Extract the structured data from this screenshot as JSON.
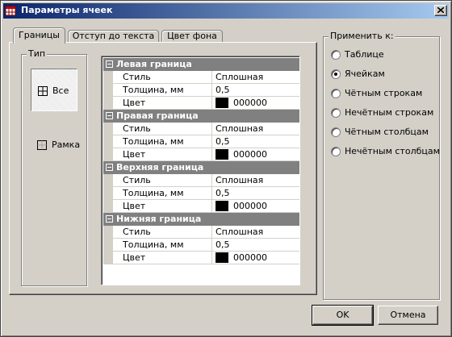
{
  "window": {
    "title": "Параметры ячеек"
  },
  "tabs": [
    {
      "label": "Границы",
      "active": true
    },
    {
      "label": "Отступ до текста",
      "active": false
    },
    {
      "label": "Цвет фона",
      "active": false
    }
  ],
  "type_group": {
    "title": "Тип",
    "options": [
      {
        "label": "Все",
        "icon": "all-borders-icon",
        "selected": true
      },
      {
        "label": "Рамка",
        "icon": "outer-border-icon",
        "selected": false
      }
    ]
  },
  "grid": {
    "categories": [
      {
        "name": "Левая граница",
        "style_label": "Стиль",
        "style_value": "Сплошная",
        "width_label": "Толщина, мм",
        "width_value": "0,5",
        "color_label": "Цвет",
        "color_value": "000000"
      },
      {
        "name": "Правая граница",
        "style_label": "Стиль",
        "style_value": "Сплошная",
        "width_label": "Толщина, мм",
        "width_value": "0,5",
        "color_label": "Цвет",
        "color_value": "000000"
      },
      {
        "name": "Верхняя граница",
        "style_label": "Стиль",
        "style_value": "Сплошная",
        "width_label": "Толщина, мм",
        "width_value": "0,5",
        "color_label": "Цвет",
        "color_value": "000000"
      },
      {
        "name": "Нижняя граница",
        "style_label": "Стиль",
        "style_value": "Сплошная",
        "width_label": "Толщина, мм",
        "width_value": "0,5",
        "color_label": "Цвет",
        "color_value": "000000"
      }
    ],
    "swatch_color": "#000000"
  },
  "apply_to": {
    "title": "Применить к:",
    "options": [
      {
        "label": "Таблице",
        "checked": false
      },
      {
        "label": "Ячейкам",
        "checked": true
      },
      {
        "label": "Чётным строкам",
        "checked": false
      },
      {
        "label": "Нечётным строкам",
        "checked": false
      },
      {
        "label": "Чётным столбцам",
        "checked": false
      },
      {
        "label": "Нечётным столбцам",
        "checked": false
      }
    ]
  },
  "buttons": {
    "ok": "OK",
    "cancel": "Отмена"
  },
  "colors": {
    "title_start": "#0a246a",
    "title_end": "#a6caf0",
    "face": "#d4d0c8",
    "category_row": "#808080"
  }
}
